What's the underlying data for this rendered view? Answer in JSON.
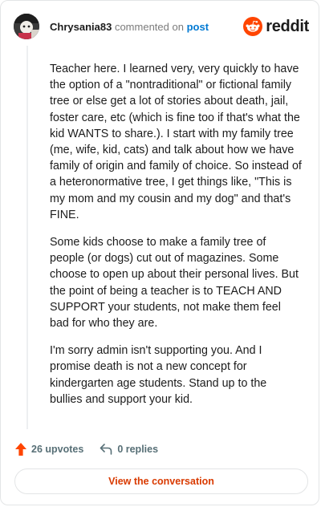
{
  "comment": {
    "username": "Chrysania83",
    "action_text": "commented on",
    "post_link": "post",
    "paragraphs": [
      "Teacher here. I learned very, very quickly to have the option of a \"nontraditional\" or fictional family tree or else get a lot of stories about death, jail, foster care, etc (which is fine too if that's what the kid WANTS to share.). I start with my family tree (me, wife, kid, cats) and talk about how we have family of origin and family of choice. So instead of a heteronormative tree, I get things like, \"This is my mom and my cousin and my dog\" and that's FINE.",
      "Some kids choose to make a family tree of people (or dogs) cut out of magazines. Some choose to open up about their personal lives. But the point of being a teacher is to TEACH AND SUPPORT your students, not make them feel bad for who they are.",
      "I'm sorry admin isn't supporting you. And I promise death is not a new concept for kindergarten age students. Stand up to the bullies and support your kid."
    ]
  },
  "brand": {
    "name": "reddit",
    "icon": "reddit-logo-icon",
    "color": "#ff4500"
  },
  "actions": {
    "upvotes": "26 upvotes",
    "upvote_icon": "upvote-arrow-icon",
    "replies": "0 replies",
    "reply_icon": "reply-arrow-icon"
  },
  "cta": {
    "label": "View the conversation",
    "color": "#d93a00"
  },
  "colors": {
    "link": "#0079d3",
    "muted": "#576f76",
    "upvote": "#ff4500"
  }
}
